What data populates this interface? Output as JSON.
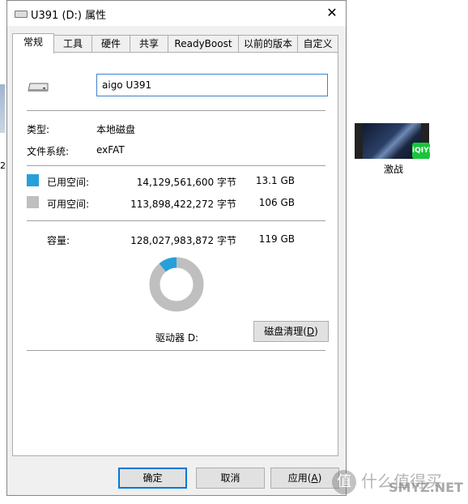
{
  "window": {
    "title": "U391 (D:) 属性",
    "close_glyph": "✕"
  },
  "tabs": [
    {
      "label": "常规",
      "active": true
    },
    {
      "label": "工具",
      "active": false
    },
    {
      "label": "硬件",
      "active": false
    },
    {
      "label": "共享",
      "active": false
    },
    {
      "label": "ReadyBoost",
      "active": false
    },
    {
      "label": "以前的版本",
      "active": false
    },
    {
      "label": "自定义",
      "active": false
    }
  ],
  "general": {
    "drive_icon": "usb-drive-icon",
    "volume_name": "aigo U391",
    "type_label": "类型:",
    "type_value": "本地磁盘",
    "fs_label": "文件系统:",
    "fs_value": "exFAT",
    "used_label": "已用空间:",
    "used_bytes": "14,129,561,600 字节",
    "used_size": "13.1 GB",
    "used_color": "#26a0da",
    "free_label": "可用空间:",
    "free_bytes": "113,898,422,272 字节",
    "free_size": "106 GB",
    "free_color": "#bfbfbf",
    "capacity_label": "容量:",
    "capacity_bytes": "128,027,983,872 字节",
    "capacity_size": "119 GB",
    "used_fraction": 0.11,
    "drive_label": "驱动器 D:",
    "cleanup_button_prefix": "磁盘清理(",
    "cleanup_button_key": "D",
    "cleanup_button_suffix": ")"
  },
  "buttons": {
    "ok": "确定",
    "cancel": "取消",
    "apply_prefix": "应用(",
    "apply_key": "A",
    "apply_suffix": ")"
  },
  "desktop": {
    "item_label": "激战",
    "badge_text": "iQIYI",
    "left_edge_char": "2"
  },
  "watermark": {
    "line1": "什么值得买",
    "line2": "SMYZ.NET",
    "glyph": "值"
  }
}
